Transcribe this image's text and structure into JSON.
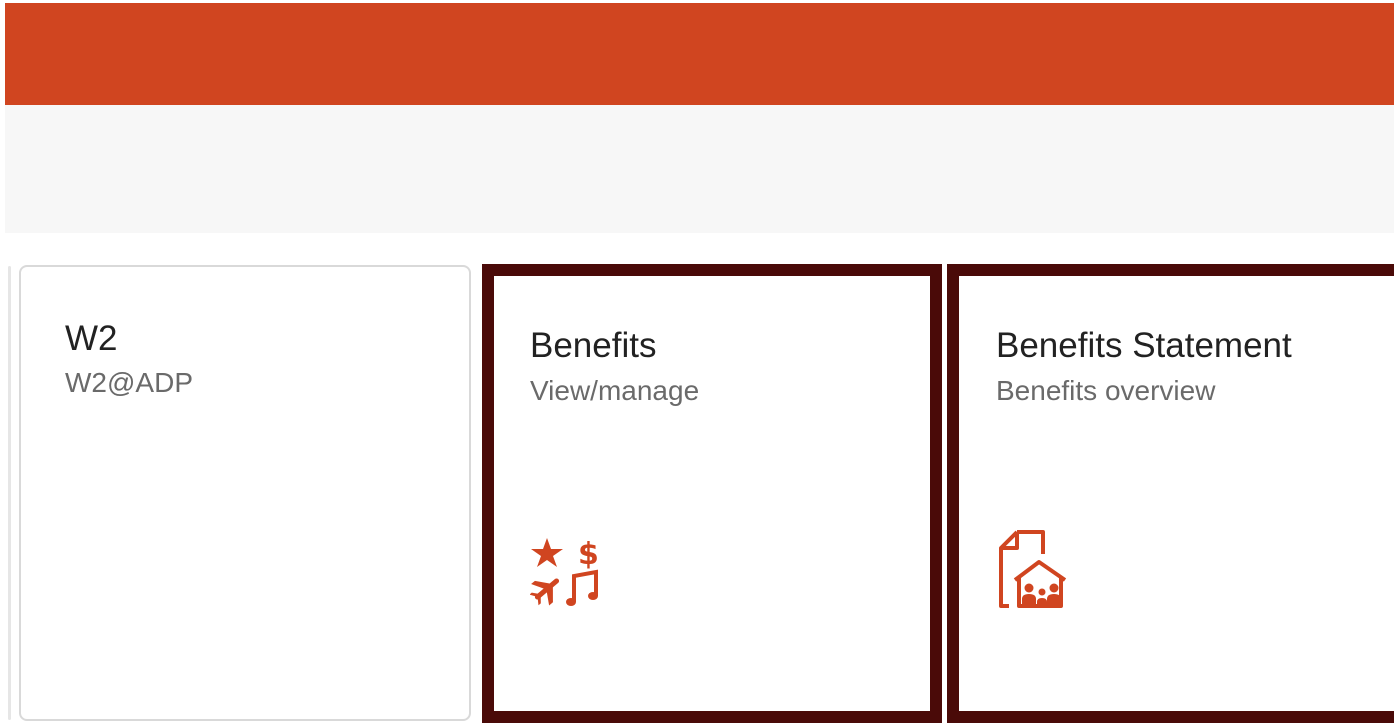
{
  "colors": {
    "header_bar": "#d04520",
    "icon_accent": "#d04520",
    "selection_border": "#4a0a08"
  },
  "tiles": [
    {
      "title": "W2",
      "subtitle": "W2@ADP",
      "icon": null,
      "selected": false
    },
    {
      "title": "Benefits",
      "subtitle": "View/manage",
      "icon": "benefits-perks-icon",
      "selected": true
    },
    {
      "title": "Benefits Statement",
      "subtitle": "Benefits overview",
      "icon": "document-family-house-icon",
      "selected": true
    }
  ]
}
